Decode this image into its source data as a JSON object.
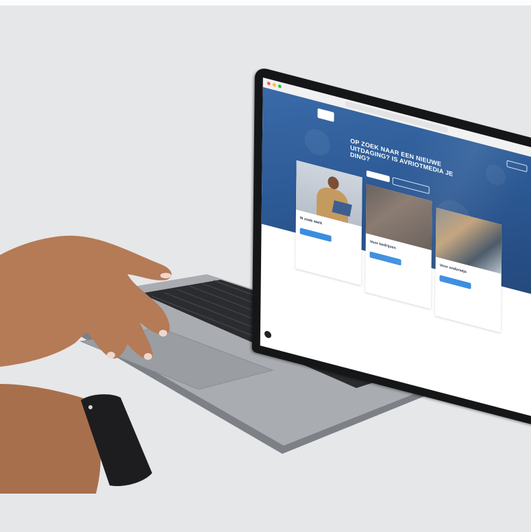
{
  "scene": {
    "background_color": "#e6e7e9",
    "subject": "laptop-on-hand",
    "objects": [
      "laptop",
      "hand",
      "smartwatch"
    ]
  },
  "website": {
    "browser": {
      "address": ""
    },
    "logo_text": "",
    "nav": {
      "items": [
        "",
        "",
        "",
        "",
        ""
      ],
      "cta": ""
    },
    "hero": {
      "headline": "OP ZOEK NAAR EEN NIEUWE UITDAGING? IS AVRIOTMEDIA JE DING?",
      "subline": "",
      "primary_button": "",
      "secondary_button": ""
    },
    "cards": [
      {
        "title": "Ik zoek werk",
        "subtitle": "",
        "button": "",
        "description": ""
      },
      {
        "title": "Voor bedrijven",
        "subtitle": "",
        "button": "",
        "description": ""
      },
      {
        "title": "Voor onderwijs",
        "subtitle": "",
        "button": "",
        "description": ""
      }
    ],
    "colors": {
      "hero_blue": "#2d5b97",
      "button_blue": "#3b8de0",
      "card_white": "#ffffff"
    }
  }
}
